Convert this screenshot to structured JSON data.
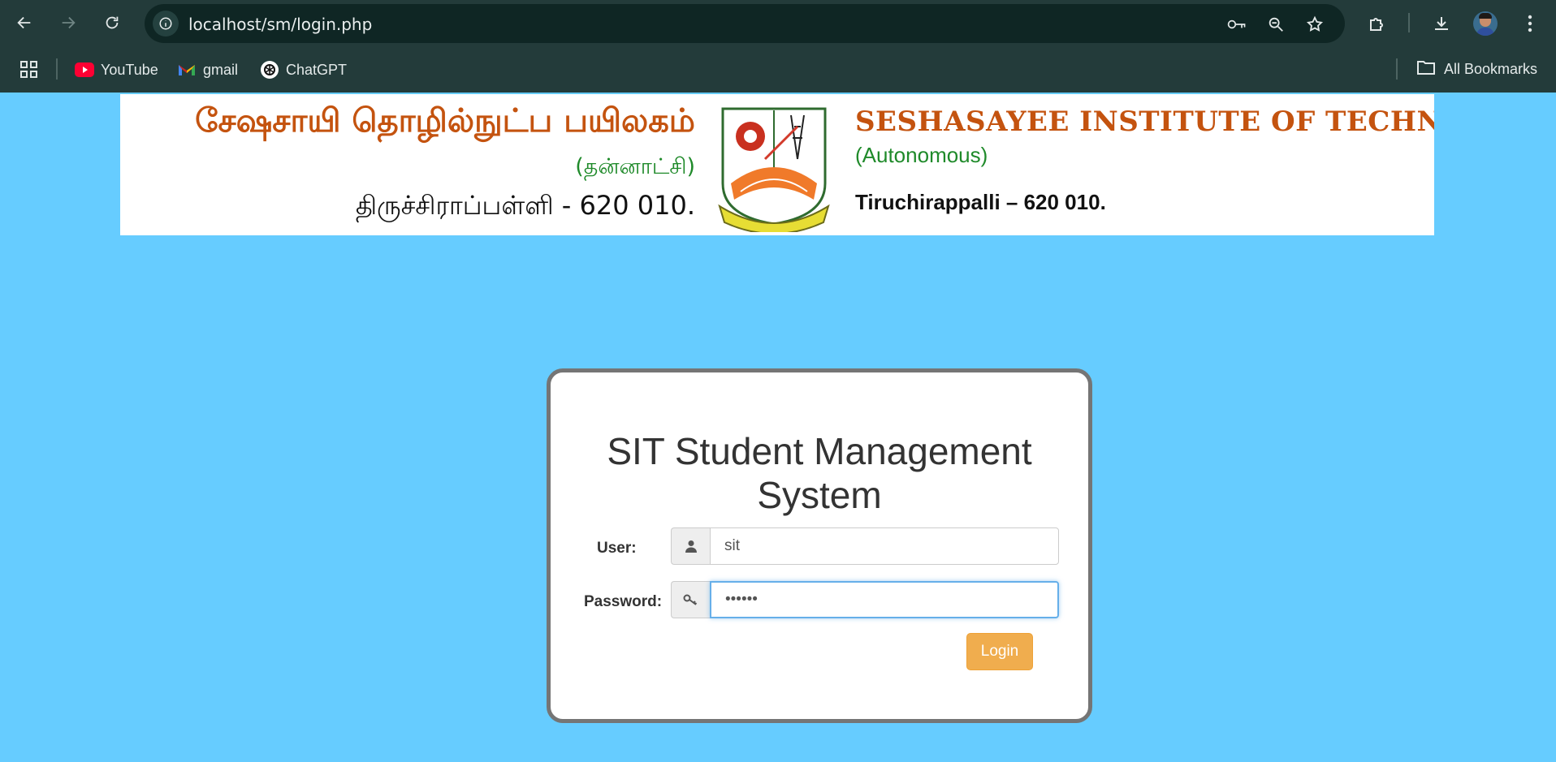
{
  "browser": {
    "url": "localhost/sm/login.php",
    "bookmarks": [
      {
        "label": "YouTube",
        "icon": "youtube-icon"
      },
      {
        "label": "gmail",
        "icon": "gmail-icon"
      },
      {
        "label": "ChatGPT",
        "icon": "chatgpt-icon"
      }
    ],
    "all_bookmarks_label": "All Bookmarks"
  },
  "banner": {
    "tamil_name": "சேஷசாயி தொழில்நுட்ப  பயிலகம்",
    "tamil_autonomous": "(தன்னாட்சி)",
    "tamil_city": "திருச்சிராப்பள்ளி  -  620  010.",
    "english_name": "SESHASAYEE INSTITUTE OF TECHNOLOGY",
    "english_autonomous": "(Autonomous)",
    "english_city": "Tiruchirappalli – 620 010."
  },
  "login": {
    "title": "SIT Student Management System",
    "user_label": "User:",
    "user_value": "sit",
    "password_label": "Password:",
    "password_value": "••••••",
    "button_label": "Login"
  },
  "colors": {
    "page_background": "#66ccff",
    "login_button": "#f0ad4e",
    "banner_title": "#c4530f",
    "banner_autonomous": "#1f8a2a"
  }
}
